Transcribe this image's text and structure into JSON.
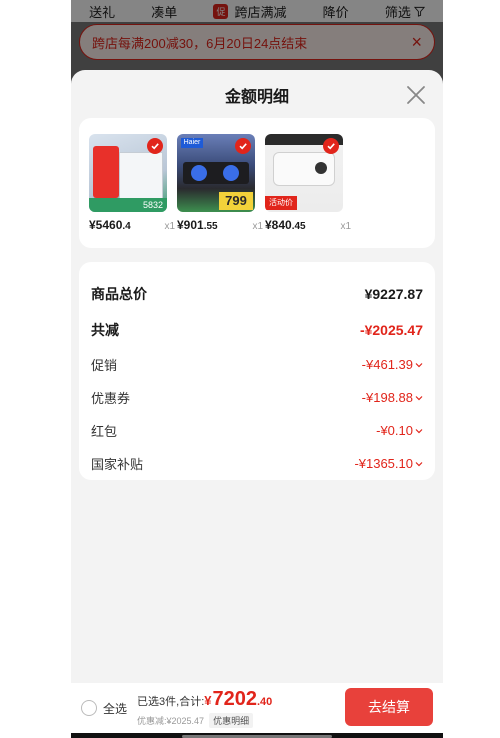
{
  "filter_bar": {
    "items": [
      "送礼",
      "凑单",
      "跨店满减",
      "降价",
      "筛选"
    ],
    "promo_chip": "促"
  },
  "notice": {
    "text": "跨店每满200减30，6月20日24点结束",
    "close": "×"
  },
  "sheet": {
    "title": "金额明细",
    "products": [
      {
        "price_main": "¥5460",
        "price_dec": ".4",
        "qty": "x1",
        "thumb_color": "#c9d6e4",
        "label": "5832"
      },
      {
        "price_main": "¥901",
        "price_dec": ".55",
        "qty": "x1",
        "thumb_color": "#2f2f33",
        "label": "799"
      },
      {
        "price_main": "¥840",
        "price_dec": ".45",
        "qty": "x1",
        "thumb_color": "#e9e9e9",
        "label": "活动价"
      }
    ],
    "rows": [
      {
        "label": "商品总价",
        "value": "¥9227.87"
      },
      {
        "label": "共减",
        "value": "-¥2025.47"
      },
      {
        "label": "促销",
        "value": "-¥461.39"
      },
      {
        "label": "优惠券",
        "value": "-¥198.88"
      },
      {
        "label": "红包",
        "value": "-¥0.10"
      },
      {
        "label": "国家补贴",
        "value": "-¥1365.10"
      }
    ]
  },
  "bottom_bar": {
    "select_all": "全选",
    "summary_prefix": "已选3件,合计:",
    "currency": "¥",
    "total_main": "7202",
    "total_dec": ".40",
    "discount_text": "优惠减:¥2025.47",
    "detail_tag": "优惠明细",
    "checkout_label": "去结算"
  },
  "colors": {
    "accent": "#e1251b",
    "checkout": "#e8413b"
  }
}
